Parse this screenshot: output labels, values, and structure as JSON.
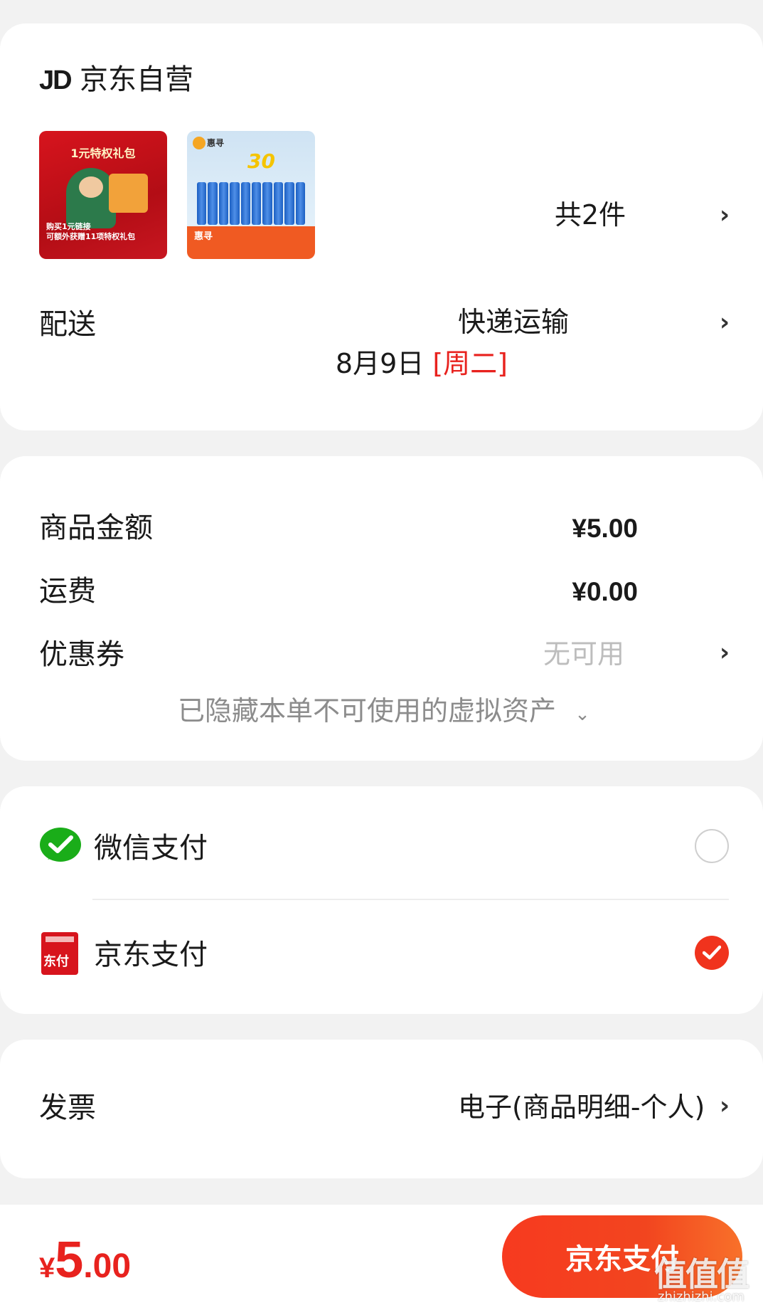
{
  "store": {
    "logo": "JD",
    "name": "京东自营",
    "thumbnails": [
      {
        "title": "1元特权礼包",
        "subtitle": "购买1元链接\n可额外获赠11项特权礼包"
      },
      {
        "brand": "惠寻",
        "badge": "30"
      }
    ],
    "item_count": "共2件"
  },
  "delivery": {
    "label": "配送",
    "method": "快递运输",
    "date": "8月9日",
    "weekday": "[周二]"
  },
  "summary": {
    "goods_label": "商品金额",
    "goods_value": "¥5.00",
    "shipping_label": "运费",
    "shipping_value": "¥0.00",
    "coupon_label": "优惠券",
    "coupon_value": "无可用",
    "hidden_note": "已隐藏本单不可使用的虚拟资产"
  },
  "payment": {
    "options": [
      {
        "label": "微信支付",
        "selected": false
      },
      {
        "label": "京东支付",
        "selected": true
      }
    ],
    "jd_icon_text": "东付"
  },
  "invoice": {
    "label": "发票",
    "value": "电子(商品明细-个人)"
  },
  "footer": {
    "currency": "¥",
    "total_int": "5",
    "total_dec": ".00",
    "pay_button": "京东支付"
  },
  "watermark": {
    "text": "值值值",
    "domain": "zhizhizhi.com"
  },
  "colors": {
    "accent": "#e8221e",
    "button": "#f73a1f",
    "wechat": "#1aad19"
  }
}
